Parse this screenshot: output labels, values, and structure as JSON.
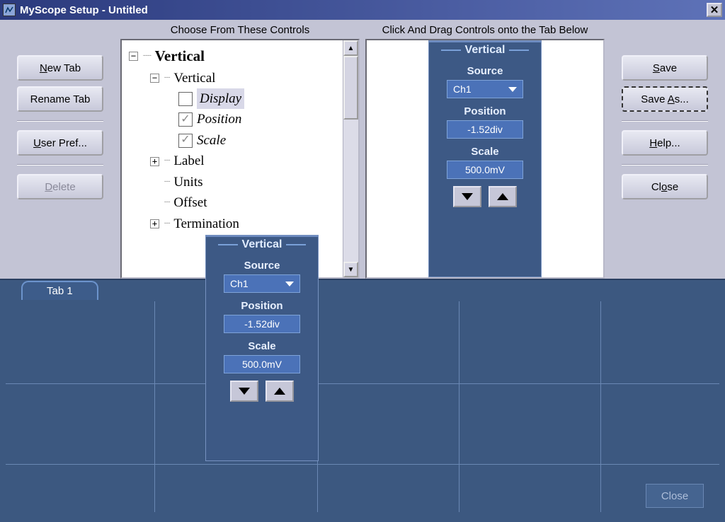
{
  "window": {
    "title": "MyScope Setup - Untitled"
  },
  "headers": {
    "left": "Choose From These Controls",
    "right": "Click And Drag Controls onto the Tab Below"
  },
  "buttons": {
    "new_tab": "New Tab",
    "rename_tab": "Rename Tab",
    "user_pref": "User Pref...",
    "delete": "Delete",
    "save": "Save",
    "save_as": "Save As...",
    "help": "Help...",
    "close": "Close",
    "bottom_close": "Close"
  },
  "tree": {
    "root": "Vertical",
    "vertical": "Vertical",
    "display": "Display",
    "position": "Position",
    "scale": "Scale",
    "label": "Label",
    "units": "Units",
    "offset": "Offset",
    "termination": "Termination"
  },
  "panel": {
    "title": "Vertical",
    "source_label": "Source",
    "source_value": "Ch1",
    "position_label": "Position",
    "position_value": "-1.52div",
    "scale_label": "Scale",
    "scale_value": "500.0mV"
  },
  "tabs": {
    "tab1": "Tab 1"
  }
}
